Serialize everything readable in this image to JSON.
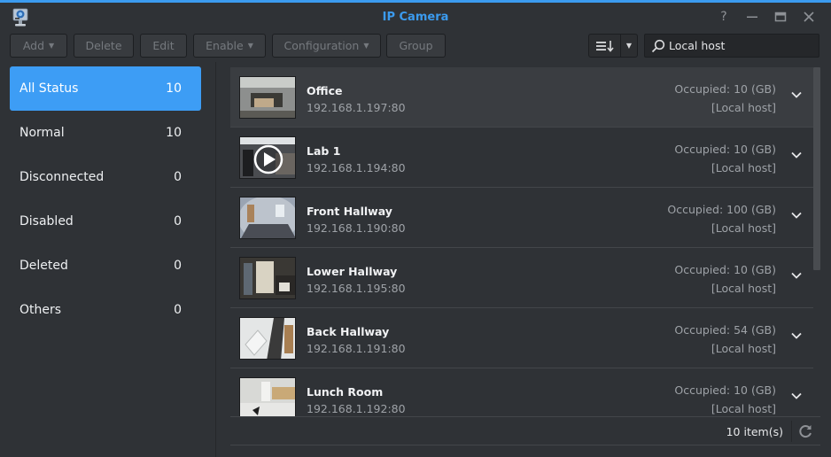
{
  "window": {
    "title": "IP Camera",
    "accent_color": "#3b9bef",
    "controls": [
      {
        "name": "help-button",
        "icon": "help-icon",
        "glyph": "?"
      },
      {
        "name": "minimize-button",
        "icon": "minimize-icon",
        "glyph": "—"
      },
      {
        "name": "maximize-button",
        "icon": "maximize-icon",
        "glyph": "▭"
      },
      {
        "name": "close-button",
        "icon": "close-icon",
        "glyph": "✕"
      }
    ]
  },
  "toolbar": {
    "add_label": "Add",
    "delete_label": "Delete",
    "edit_label": "Edit",
    "enable_label": "Enable",
    "configuration_label": "Configuration",
    "group_label": "Group",
    "sort_icon": "sort-icon",
    "search": {
      "value": "Local host",
      "placeholder": "Search"
    }
  },
  "sidebar": {
    "items": [
      {
        "label": "All Status",
        "count": "10",
        "active": true
      },
      {
        "label": "Normal",
        "count": "10"
      },
      {
        "label": "Disconnected",
        "count": "0"
      },
      {
        "label": "Disabled",
        "count": "0"
      },
      {
        "label": "Deleted",
        "count": "0"
      },
      {
        "label": "Others",
        "count": "0"
      }
    ]
  },
  "cameras": [
    {
      "name": "Office",
      "address": "192.168.1.197:80",
      "occupied": "Occupied: 10 (GB)",
      "host": "[Local host]"
    },
    {
      "name": "Lab 1",
      "address": "192.168.1.194:80",
      "occupied": "Occupied: 10 (GB)",
      "host": "[Local host]",
      "play_overlay": true
    },
    {
      "name": "Front Hallway",
      "address": "192.168.1.190:80",
      "occupied": "Occupied: 100 (GB)",
      "host": "[Local host]"
    },
    {
      "name": "Lower Hallway",
      "address": "192.168.1.195:80",
      "occupied": "Occupied: 10 (GB)",
      "host": "[Local host]"
    },
    {
      "name": "Back Hallway",
      "address": "192.168.1.191:80",
      "occupied": "Occupied: 54 (GB)",
      "host": "[Local host]"
    },
    {
      "name": "Lunch Room",
      "address": "192.168.1.192:80",
      "occupied": "Occupied: 10 (GB)",
      "host": "[Local host]"
    }
  ],
  "footer": {
    "item_count": "10 item(s)"
  }
}
